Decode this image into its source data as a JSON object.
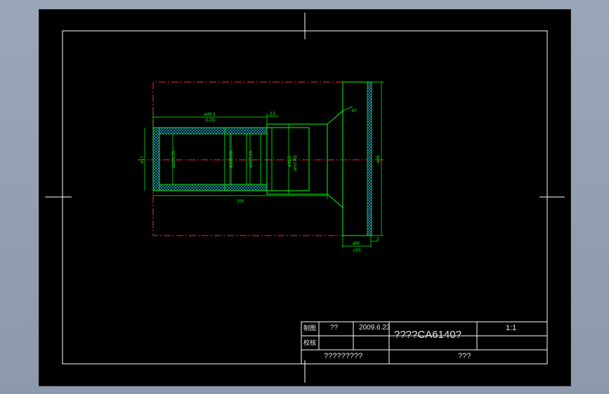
{
  "drawing": {
    "dims": {
      "d_outer_main": "ø17",
      "d_bore_left": "ø12/0.05",
      "d_bore_mid": "ø10/0.05",
      "d_bore_right": "ø10/0.05",
      "d_step": "ø32.5",
      "d_step_tol": "(ø+0.05)",
      "d_flange": "ø56",
      "len_top": "ø45.3",
      "len_top_sub": "(123)",
      "len_small": "2.5",
      "len_bottom": "200",
      "len_flange": "ø50",
      "len_flange_sub": "(30)",
      "thk_flange": "3",
      "angle": "30°"
    }
  },
  "title_block": {
    "row1_label": "制图",
    "row2_label": "校核",
    "drawer": "??",
    "date": "2009.6.23",
    "title": "????CA6140?",
    "scale": "1:1",
    "bottom_left": "?????????",
    "bottom_right": "???"
  },
  "colors": {
    "background": "#000000",
    "border": "#ffffff",
    "part_outline": "#00ff00",
    "centerline": "#ff0000",
    "hatch": "#00c8ff"
  }
}
